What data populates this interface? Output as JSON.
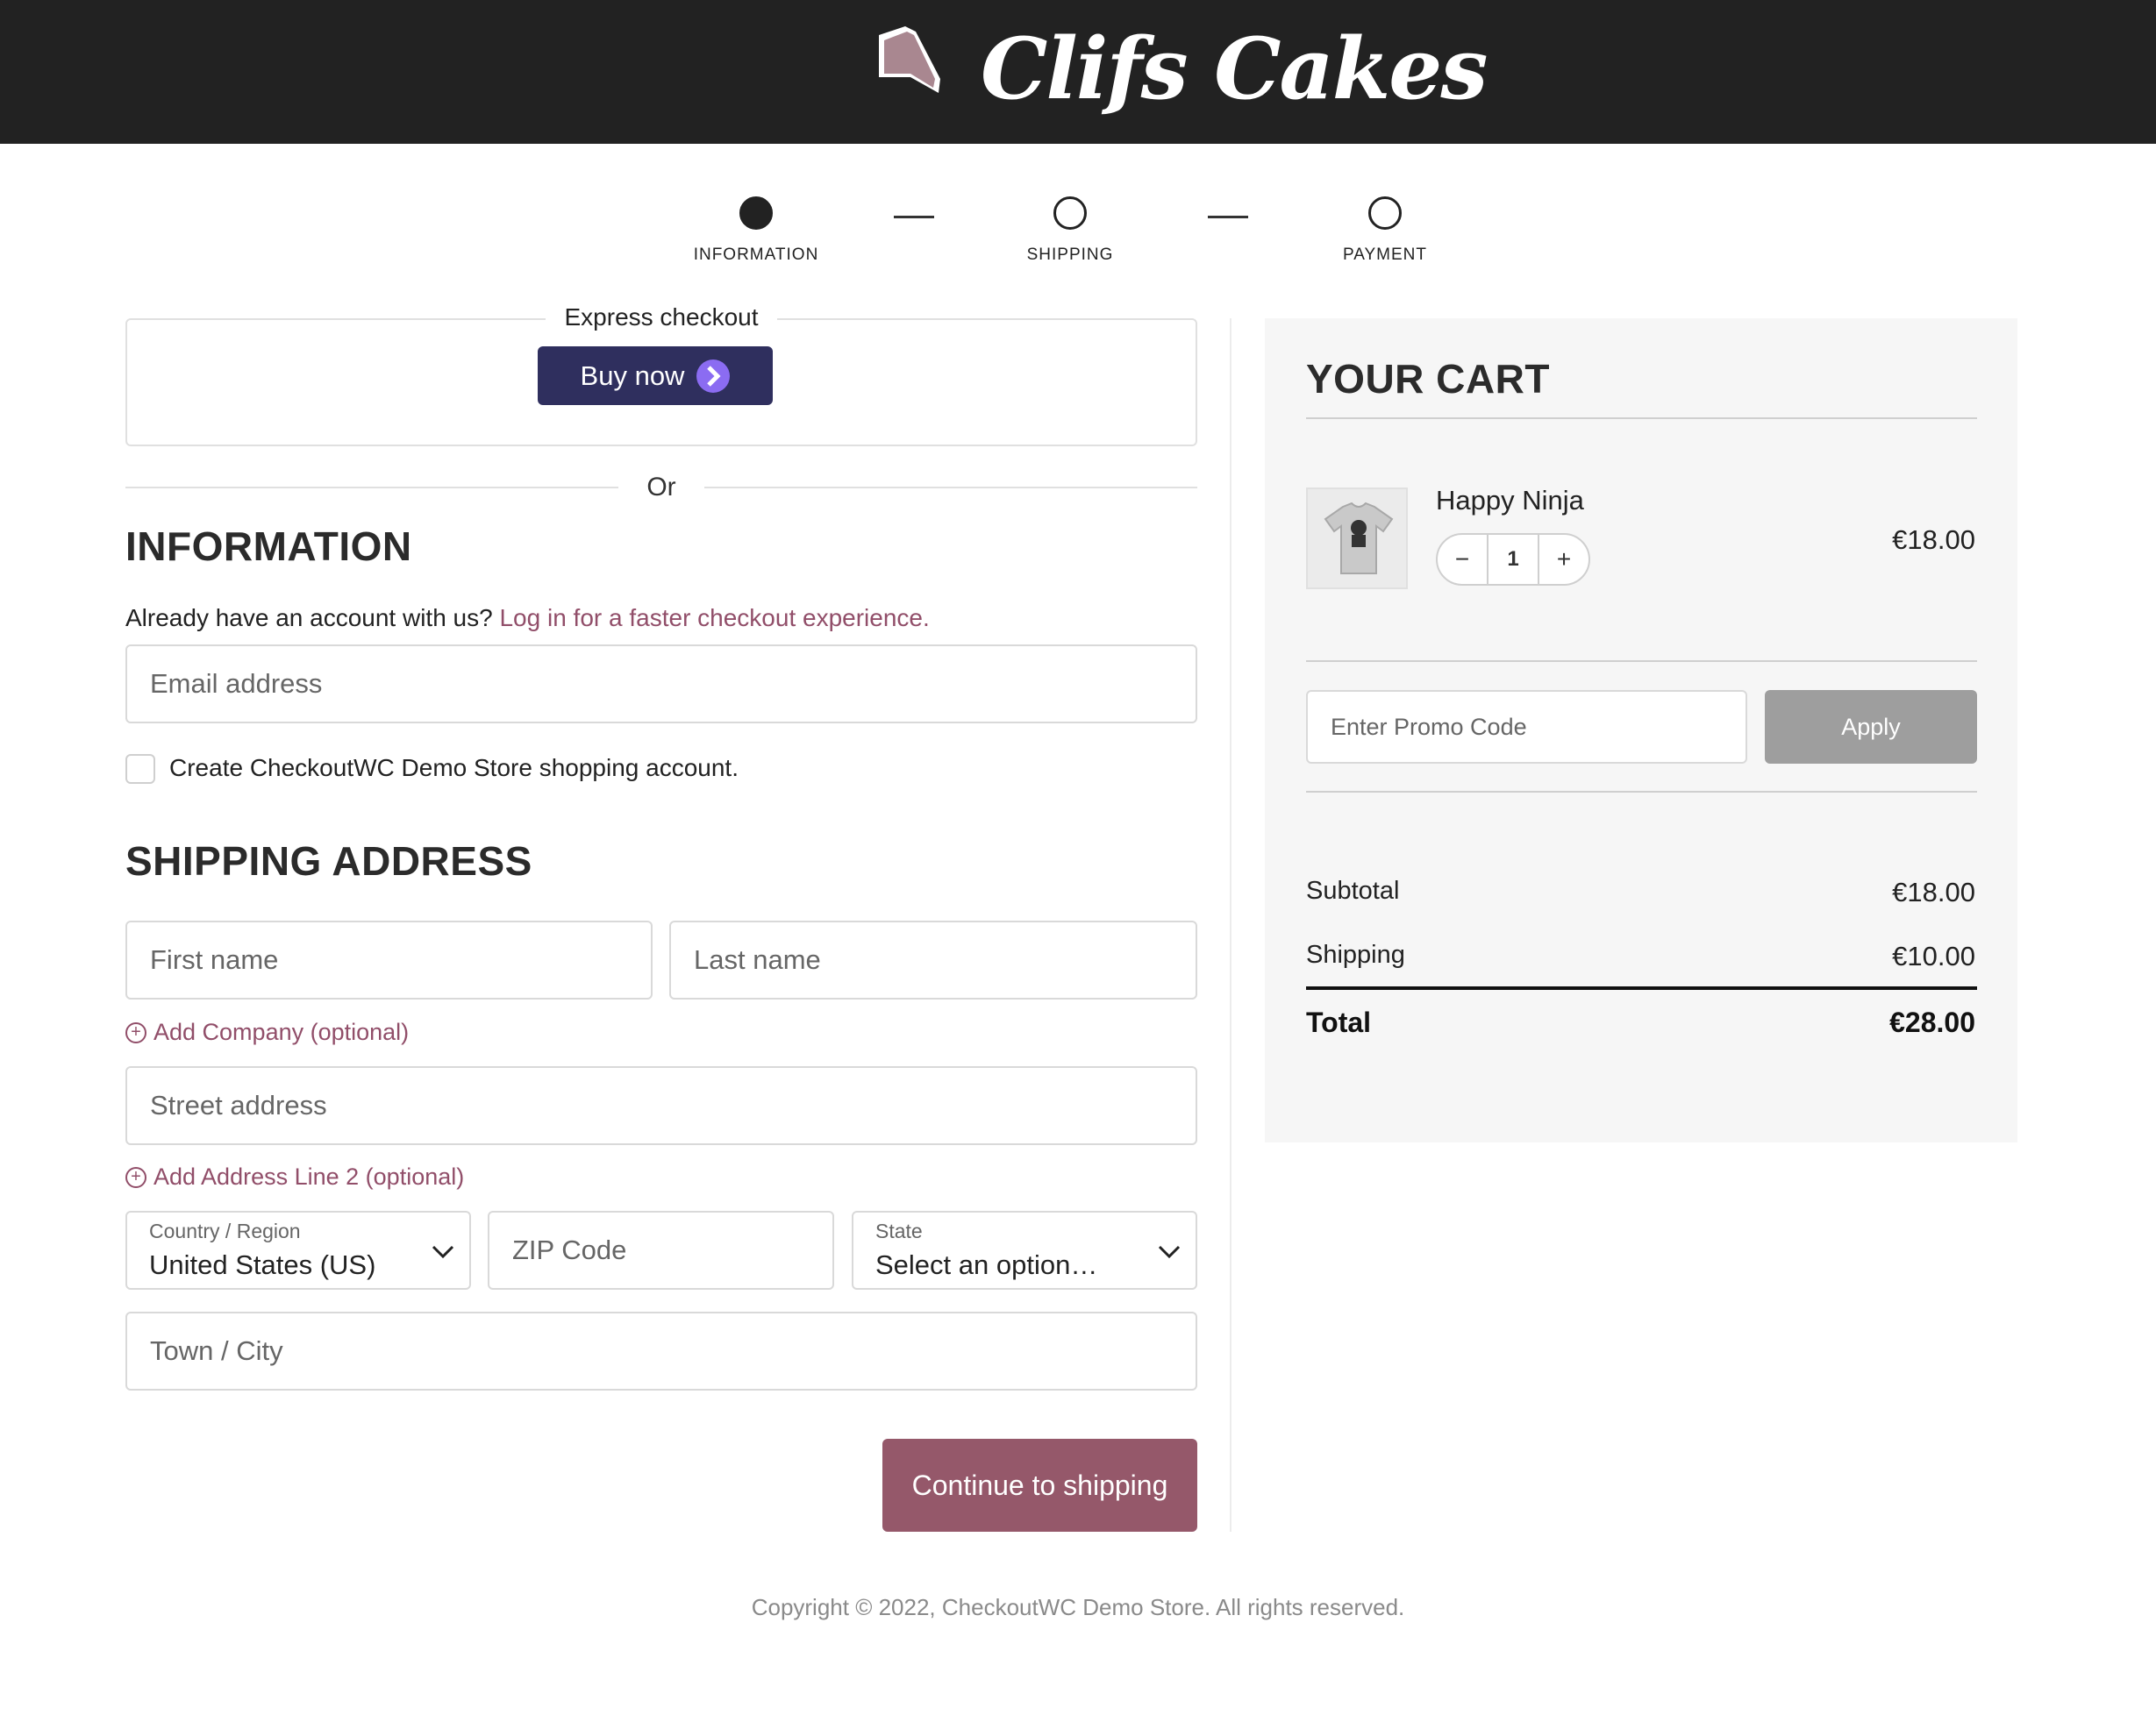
{
  "header": {
    "brand": "Clifs Cakes"
  },
  "steps": [
    {
      "label": "INFORMATION",
      "active": true
    },
    {
      "label": "SHIPPING",
      "active": false
    },
    {
      "label": "PAYMENT",
      "active": false
    }
  ],
  "express": {
    "title": "Express checkout",
    "button_label": "Buy now",
    "or_label": "Or"
  },
  "information": {
    "heading": "INFORMATION",
    "account_prompt": "Already have an account with us?",
    "login_link": "Log in for a faster checkout experience.",
    "email_placeholder": "Email address",
    "create_account_label": "Create CheckoutWC Demo Store shopping account.",
    "create_account_checked": false
  },
  "shipping": {
    "heading": "SHIPPING ADDRESS",
    "first_name_placeholder": "First name",
    "last_name_placeholder": "Last name",
    "add_company": "Add Company (optional)",
    "street_placeholder": "Street address",
    "add_line2": "Add Address Line 2 (optional)",
    "country_label": "Country / Region",
    "country_value": "United States (US)",
    "zip_placeholder": "ZIP Code",
    "state_label": "State",
    "state_value": "Select an option…",
    "city_placeholder": "Town / City",
    "continue_label": "Continue to shipping"
  },
  "cart": {
    "heading": "YOUR CART",
    "items": [
      {
        "name": "Happy Ninja",
        "qty": "1",
        "price": "€18.00",
        "thumbnail_icon": "tshirt-icon"
      }
    ],
    "promo_placeholder": "Enter Promo Code",
    "apply_label": "Apply",
    "subtotal_label": "Subtotal",
    "subtotal_value": "€18.00",
    "shipping_label": "Shipping",
    "shipping_value": "€10.00",
    "total_label": "Total",
    "total_value": "€28.00"
  },
  "footer": {
    "copyright": "Copyright © 2022, CheckoutWC Demo Store. All rights reserved."
  },
  "colors": {
    "accent": "#914e69",
    "header_bg": "#222222",
    "buy_now_bg": "#2f2f5e",
    "apply_bg": "#9e9e9e",
    "continue_bg": "#95586a"
  }
}
